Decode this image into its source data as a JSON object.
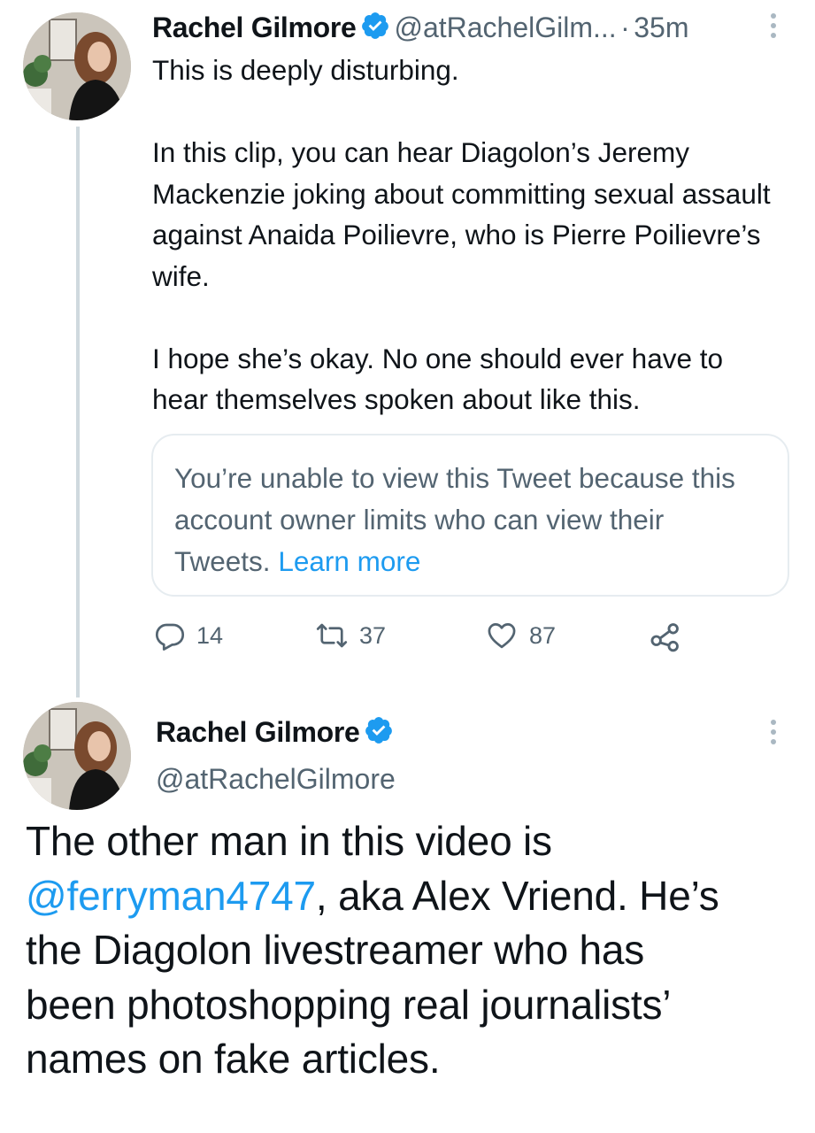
{
  "tweet1": {
    "author_name": "Rachel Gilmore",
    "handle": "@atRachelGilm...",
    "separator": "·",
    "time": "35m",
    "body": "This is deeply disturbing.\n\nIn this clip, you can hear Diagolon’s Jeremy Mackenzie joking about committing sexual assault against Anaida Poilievre, who is Pierre Poilievre’s wife.\n\nI hope she’s okay. No one should ever have to hear themselves spoken about like this.",
    "quote_notice": "You’re unable to view this Tweet because this account owner limits who can view their Tweets.",
    "quote_link": "Learn more",
    "actions": {
      "replies": "14",
      "retweets": "37",
      "likes": "87"
    }
  },
  "tweet2": {
    "author_name": "Rachel Gilmore",
    "handle": "@atRachelGilmore",
    "mention": "@ferryman4747",
    "body_before": "The other man in this video is\n",
    "body_after": ", aka Alex Vriend. He’s\nthe Diagolon livestreamer who has\nbeen photoshopping real journalists’\nnames on fake articles."
  },
  "colors": {
    "accent": "#1d9bf0",
    "secondary_text": "#536471",
    "border": "#e6ecf0"
  }
}
